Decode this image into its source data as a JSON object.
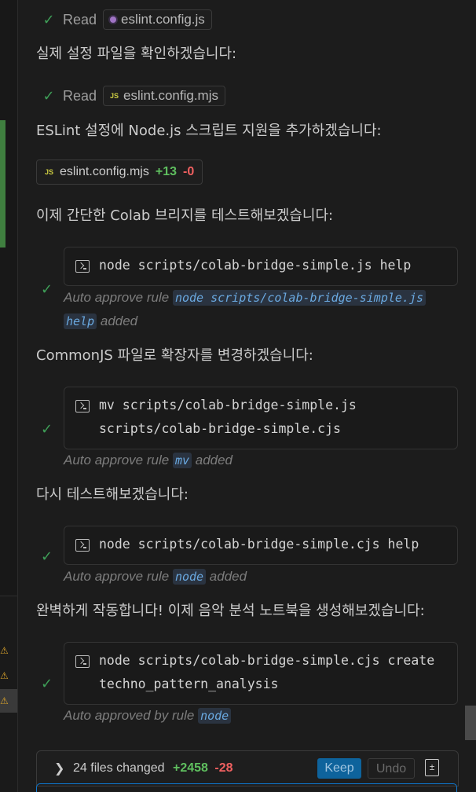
{
  "steps": [
    {
      "kind": "read",
      "verb": "Read",
      "file": "eslint.config.js"
    },
    {
      "kind": "message",
      "text": "실제 설정 파일을 확인하겠습니다:"
    },
    {
      "kind": "read",
      "verb": "Read",
      "file": "eslint.config.mjs"
    },
    {
      "kind": "message",
      "text": "ESLint 설정에 Node.js 스크립트 지원을 추가하겠습니다:"
    },
    {
      "kind": "diff",
      "file": "eslint.config.mjs",
      "added": "+13",
      "removed": "-0"
    },
    {
      "kind": "message",
      "text": "이제 간단한 Colab 브리지를 테스트해보겠습니다:"
    },
    {
      "kind": "terminal",
      "lines": [
        "node scripts/colab-bridge-simple.js help"
      ],
      "note_prefix": "Auto approve rule",
      "rule_part1": "node scripts/colab-bridge-simple.js",
      "rule_part2": "help",
      "note_suffix": "added"
    },
    {
      "kind": "message",
      "text": "CommonJS 파일로 확장자를 변경하겠습니다:"
    },
    {
      "kind": "terminal",
      "lines": [
        "mv scripts/colab-bridge-simple.js",
        "scripts/colab-bridge-simple.cjs"
      ],
      "note_prefix": "Auto approve rule",
      "rule": "mv",
      "note_suffix": "added"
    },
    {
      "kind": "message",
      "text": "다시 테스트해보겠습니다:"
    },
    {
      "kind": "terminal",
      "lines": [
        "node scripts/colab-bridge-simple.cjs help"
      ],
      "note_prefix": "Auto approve rule",
      "rule": "node",
      "note_suffix": "added"
    },
    {
      "kind": "message",
      "text": "완벽하게 작동합니다! 이제 음악 분석 노트북을 생성해보겠습니다:"
    },
    {
      "kind": "terminal",
      "lines": [
        "node scripts/colab-bridge-simple.cjs create",
        "techno_pattern_analysis"
      ],
      "note_prefix": "Auto approved by rule",
      "rule": "node",
      "note_suffix": ""
    }
  ],
  "changes_bar": {
    "label": "24 files changed",
    "added": "+2458",
    "removed": "-28",
    "keep": "Keep",
    "undo": "Undo"
  },
  "colors": {
    "accent": "#0e639c",
    "success": "#3e9e57",
    "added": "#5fbf5f",
    "removed": "#f06060",
    "warning": "#d7a12b"
  }
}
